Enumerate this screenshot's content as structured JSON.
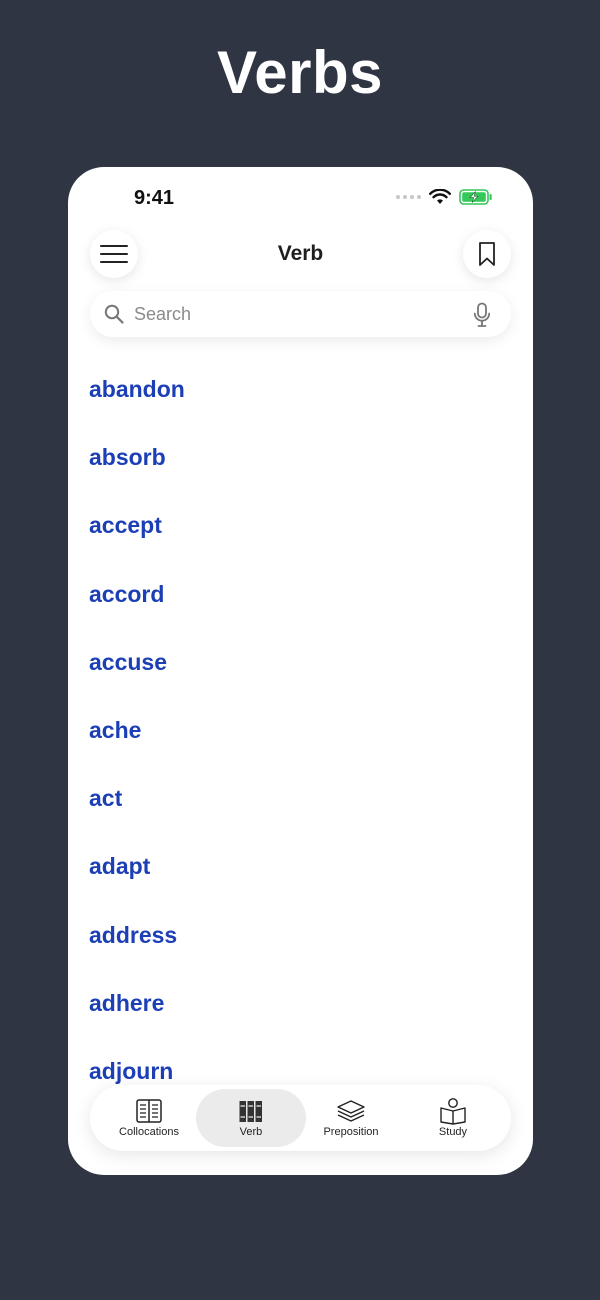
{
  "hero": {
    "title": "Verbs"
  },
  "status_bar": {
    "time": "9:41"
  },
  "header": {
    "title": "Verb"
  },
  "search": {
    "placeholder": "Search"
  },
  "words": [
    "abandon",
    "absorb",
    "accept",
    "accord",
    "accuse",
    "ache",
    "act",
    "adapt",
    "address",
    "adhere",
    "adjourn"
  ],
  "tabs": [
    {
      "label": "Collocations",
      "icon": "book-pages-icon",
      "active": false
    },
    {
      "label": "Verb",
      "icon": "books-shelf-icon",
      "active": true
    },
    {
      "label": "Preposition",
      "icon": "layers-stack-icon",
      "active": false
    },
    {
      "label": "Study",
      "icon": "reading-person-icon",
      "active": false
    }
  ],
  "colors": {
    "background": "#2f3542",
    "word_link": "#1c3fb6",
    "active_tab": "#ebebeb",
    "battery": "#34c759"
  }
}
